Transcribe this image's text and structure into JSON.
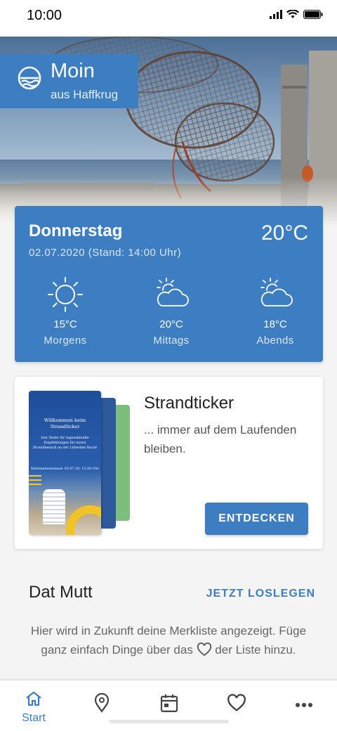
{
  "status_bar": {
    "time": "10:00"
  },
  "header": {
    "title": "Moin",
    "subtitle": "aus Haffkrug"
  },
  "weather": {
    "day": "Donnerstag",
    "date": "02.07.2020 (Stand: 14:00 Uhr)",
    "current_temp": "20°C",
    "slots": [
      {
        "temp": "15°C",
        "label": "Morgens",
        "icon": "sun-icon"
      },
      {
        "temp": "20°C",
        "label": "Mittags",
        "icon": "partly-cloudy-icon"
      },
      {
        "temp": "18°C",
        "label": "Abends",
        "icon": "partly-cloudy-icon"
      }
    ]
  },
  "strandticker": {
    "title": "Strandticker",
    "text": "... immer auf dem Laufenden bleiben.",
    "button_label": "ENTDECKEN",
    "booklet": {
      "title": "Willkommen beim Strandticker",
      "text": "hier findet ihr tagesaktuelle Empfehlungen für euren Strandbesuch an der Lübecker Bucht",
      "info": "Informationsstand: 02.07.20, 12:30 Uhr"
    }
  },
  "merkliste": {
    "title": "Dat Mutt",
    "link_label": "JETZT LOSLEGEN",
    "text_before": "Hier wird in Zukunft deine Merkliste angezeigt. Füge ganz einfach Dinge über das",
    "text_after": "der Liste hinzu."
  },
  "bottom_nav": {
    "items": [
      {
        "label": "Start",
        "icon": "home-icon",
        "active": true
      },
      {
        "label": "",
        "icon": "location-pin-icon"
      },
      {
        "label": "",
        "icon": "calendar-icon"
      },
      {
        "label": "",
        "icon": "heart-icon"
      },
      {
        "label": "",
        "icon": "more-icon"
      }
    ]
  },
  "colors": {
    "accent": "#3d7ec3",
    "background": "#f4f4f4",
    "booklet_green": "#7dbe7d",
    "booklet_yellow": "#f2c326"
  }
}
